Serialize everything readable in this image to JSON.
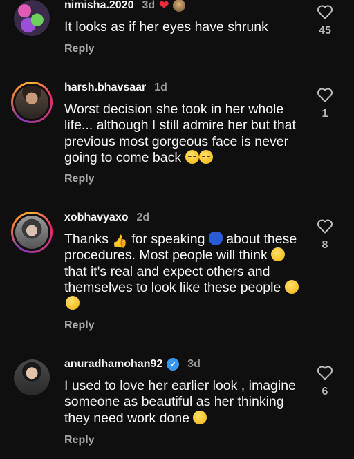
{
  "comments": [
    {
      "username": "nimisha.2020",
      "time": "3d",
      "text": "It looks as if her eyes have shrunk",
      "reply_label": "Reply",
      "likes": "45",
      "avatar_icon": "flower-avatar",
      "avatar_ring": false,
      "avatar_color": "#7a3fa0",
      "badges": [
        "red-heart-icon",
        "creator-avatar-icon"
      ]
    },
    {
      "username": "harsh.bhavsaar",
      "time": "1d",
      "text": "Worst decision she took in her whole life... although I still admire her but that previous most gorgeous face is never going to come back",
      "emoji_suffix": [
        "pensive-face",
        "pensive-face"
      ],
      "reply_label": "Reply",
      "likes": "1",
      "avatar_icon": "man-portrait-avatar",
      "avatar_ring": true,
      "avatar_color": "#5a4638"
    },
    {
      "username": "xobhavyaxo",
      "time": "2d",
      "text_parts": [
        "Thanks ",
        " for speaking ",
        " about these procedures. Most people will think ",
        " that it's real and expect others and themselves to look like these people "
      ],
      "inline_emojis": [
        "thumbs-up",
        "speaking-head",
        "thinking-face"
      ],
      "emoji_suffix": [
        "zany-face",
        "joy-face"
      ],
      "reply_label": "Reply",
      "likes": "8",
      "avatar_icon": "woman-portrait-avatar",
      "avatar_ring": true,
      "avatar_color": "#6a6a6a"
    },
    {
      "username": "anuradhamohan92",
      "verified": true,
      "time": "3d",
      "text": "I used to love her earlier look , imagine someone as beautiful as her thinking they need work done",
      "emoji_suffix": [
        "upside-down-face"
      ],
      "reply_label": "Reply",
      "likes": "6",
      "avatar_icon": "woman-portrait-avatar",
      "avatar_ring": false,
      "avatar_color": "#3b3b3b"
    }
  ],
  "colors": {
    "background": "#0f0f0f",
    "username": "#f5f5f5",
    "secondary": "#9a9a9a",
    "verified": "#3897f0",
    "heart": "#ed2b3d"
  }
}
